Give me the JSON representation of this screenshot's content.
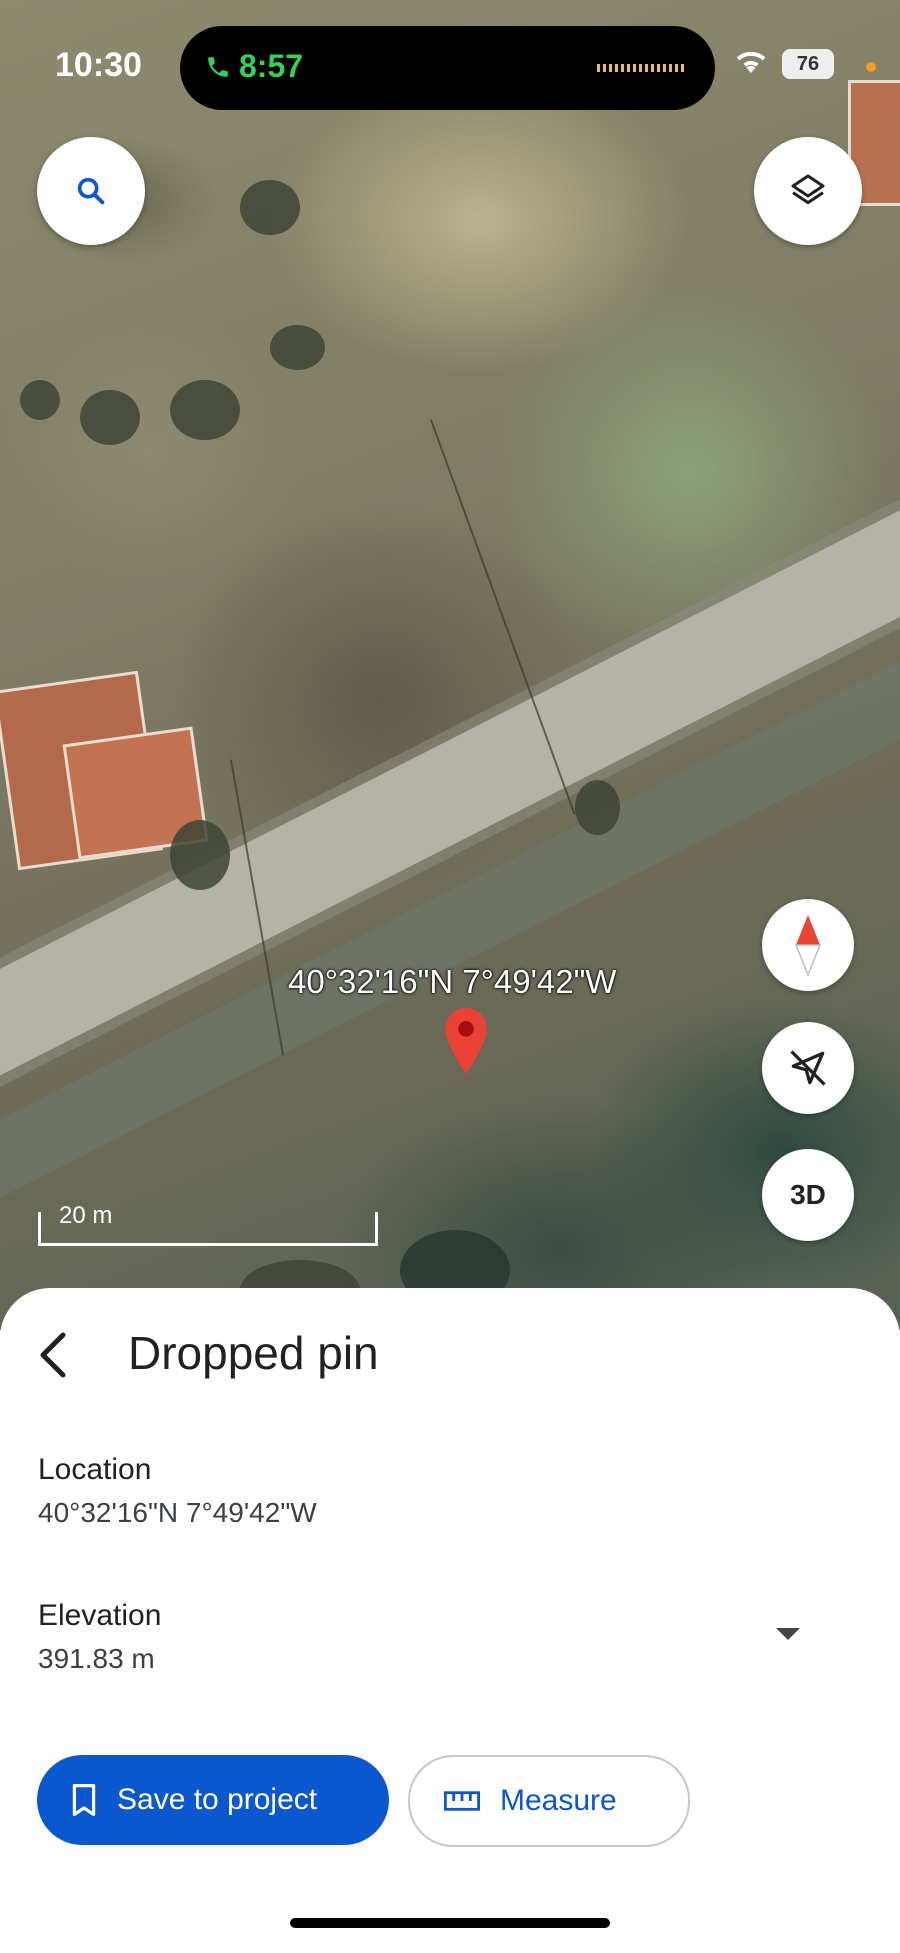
{
  "status_bar": {
    "time": "10:30",
    "call_timer": "8:57",
    "battery": "76"
  },
  "map": {
    "pin_coordinates": "40°32'16\"N 7°49'42\"W",
    "scale_label": "20 m",
    "button_3d": "3D"
  },
  "sheet": {
    "title": "Dropped pin",
    "location_label": "Location",
    "location_value": "40°32'16\"N 7°49'42\"W",
    "elevation_label": "Elevation",
    "elevation_value": "391.83 m",
    "save_button": "Save to project",
    "measure_button": "Measure"
  },
  "colors": {
    "accent": "#0b57d0",
    "pin": "#ea4335",
    "call_green": "#34d058"
  }
}
